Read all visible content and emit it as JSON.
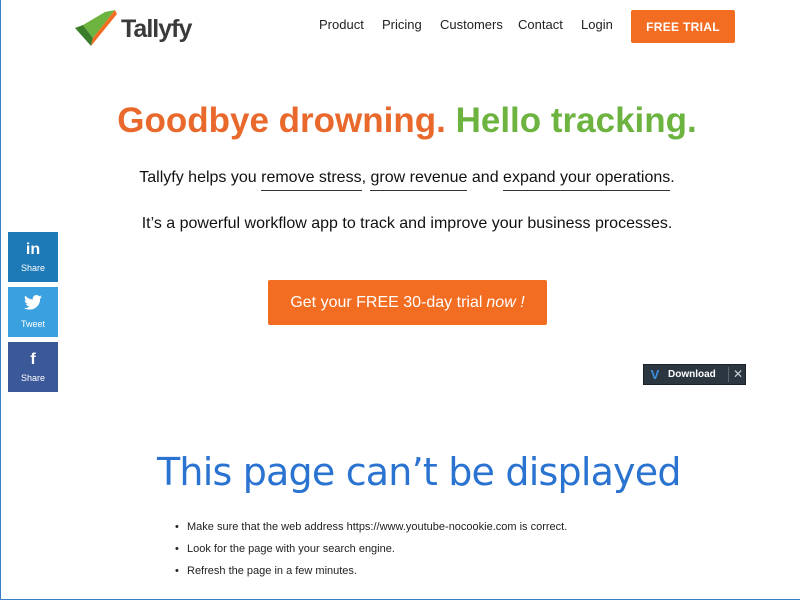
{
  "brand": {
    "name": "Tallyfy",
    "checkmark_colors": {
      "green": "#6db33f",
      "orange": "#f26d21",
      "dark_green": "#3a7d2a"
    }
  },
  "nav": {
    "items": [
      "Product",
      "Pricing",
      "Customers",
      "Contact",
      "Login"
    ],
    "trial_button": "FREE TRIAL"
  },
  "hero": {
    "headline_part1": "Goodbye drowning.",
    "headline_part2": "Hello tracking.",
    "line1": {
      "prefix": "Tallyfy helps you",
      "link1": "remove stress",
      "sep1": ",",
      "link2": "grow revenue",
      "middle": "and",
      "link3": "expand your operations",
      "suffix": "."
    },
    "line2": "It’s a powerful workflow app to track and improve your business processes.",
    "cta": {
      "main": "Get your FREE 30-day trial",
      "emphasis": "now !"
    }
  },
  "social": [
    {
      "icon": "linkedin-icon",
      "glyph": "in",
      "label": "Share",
      "color": "#1e79b7"
    },
    {
      "icon": "twitter-icon",
      "glyph": "🐦",
      "label": "Tweet",
      "color": "#3aa0df"
    },
    {
      "icon": "facebook-icon",
      "glyph": "f",
      "label": "Share",
      "color": "#3b5998"
    }
  ],
  "download_bar": {
    "logo": "V",
    "label": "Download",
    "close": "✕"
  },
  "error": {
    "title": "This page can’t be displayed",
    "items": [
      "Make sure that the web address https://www.youtube-nocookie.com is correct.",
      "Look for the page with your search engine.",
      "Refresh the page in a few minutes."
    ]
  },
  "colors": {
    "accent_orange": "#f26d21",
    "headline_orange": "#e9692c",
    "headline_green": "#6db33f",
    "error_blue": "#2a73d0"
  }
}
